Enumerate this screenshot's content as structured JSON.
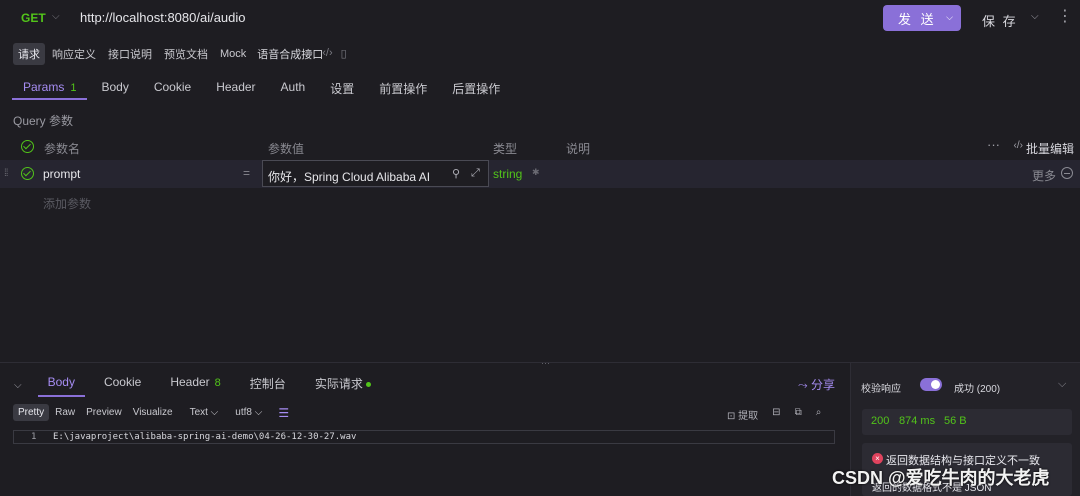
{
  "request": {
    "method": "GET",
    "url": "http://localhost:8080/ai/audio",
    "send_label": "发 送",
    "save_label": "保 存"
  },
  "subtabs": {
    "items": [
      "请求",
      "响应定义",
      "接口说明",
      "预览文档",
      "Mock"
    ],
    "title": "语音合成接口"
  },
  "tabs": {
    "params": "Params",
    "params_count": "1",
    "body": "Body",
    "cookie": "Cookie",
    "header": "Header",
    "auth": "Auth",
    "settings": "设置",
    "pre": "前置操作",
    "post": "后置操作"
  },
  "query": {
    "section_label": "Query 参数",
    "col_name": "参数名",
    "col_value": "参数值",
    "col_type": "类型",
    "col_desc": "说明",
    "bulk_edit": "批量编辑",
    "rows": [
      {
        "name": "prompt",
        "value": "你好，Spring Cloud Alibaba AI",
        "type": "string",
        "more": "更多"
      }
    ],
    "add_placeholder": "添加参数"
  },
  "response": {
    "tabs": {
      "body": "Body",
      "cookie": "Cookie",
      "header": "Header",
      "header_count": "8",
      "console": "控制台",
      "actual": "实际请求"
    },
    "share": "分享",
    "formats": [
      "Pretty",
      "Raw",
      "Preview",
      "Visualize"
    ],
    "text_select": "Text",
    "encoding_select": "utf8",
    "extract": "提取",
    "line_number": "1",
    "body_line": "E:\\javaproject\\alibaba-spring-ai-demo\\04-26-12-30-27.wav"
  },
  "validate": {
    "label": "校验响应",
    "status": "成功 (200)",
    "code": "200",
    "time": "874 ms",
    "size": "56 B",
    "error1": "返回数据结构与接口定义不一致",
    "error2": "返回的数据格式不是 JSON"
  },
  "watermark": "CSDN @爱吃牛肉的大老虎",
  "colors": {
    "accent": "#8a70d8",
    "success": "#52c41a",
    "error": "#e0435e",
    "background": "#1e1d22"
  }
}
